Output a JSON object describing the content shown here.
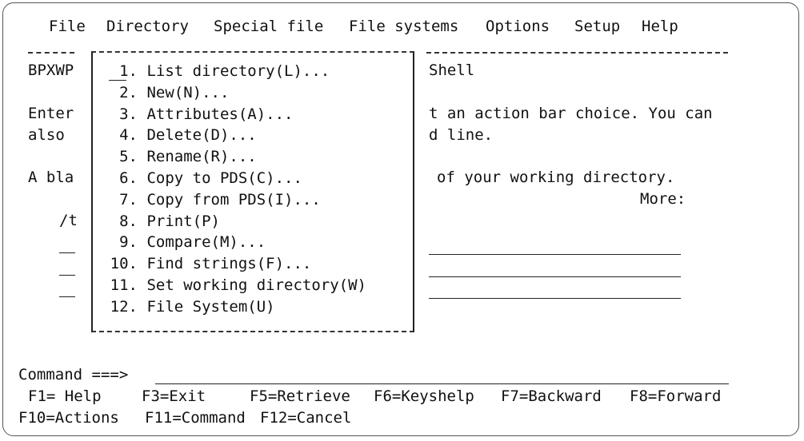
{
  "action_bar": [
    "File",
    "Directory",
    "Special file",
    "File systems",
    "Options",
    "Setup",
    "Help"
  ],
  "background": {
    "panel_id": "BPXWP",
    "panel_title": "Shell",
    "line_enter_left": "Enter",
    "line_enter_right": "t an action bar choice. You can",
    "line_also_left": "also",
    "line_also_right": "d line.",
    "line_blank_left": "A bla",
    "line_blank_right": "of your working directory.",
    "more_label": "More:",
    "path_prefix": "/t",
    "left_field_underline": "__"
  },
  "directory_menu": {
    "selection_underline": "__",
    "items": [
      {
        "num": "1.",
        "label": "List directory(L)..."
      },
      {
        "num": "2.",
        "label": "New(N)..."
      },
      {
        "num": "3.",
        "label": "Attributes(A)..."
      },
      {
        "num": "4.",
        "label": "Delete(D)..."
      },
      {
        "num": "5.",
        "label": "Rename(R)..."
      },
      {
        "num": "6.",
        "label": "Copy to PDS(C)..."
      },
      {
        "num": "7.",
        "label": "Copy from PDS(I)..."
      },
      {
        "num": "8.",
        "label": "Print(P)"
      },
      {
        "num": "9.",
        "label": "Compare(M)..."
      },
      {
        "num": "10.",
        "label": "Find strings(F)..."
      },
      {
        "num": "11.",
        "label": "Set working directory(W)"
      },
      {
        "num": "12.",
        "label": "File System(U)"
      }
    ]
  },
  "command": {
    "prompt": "Command ===>",
    "value": ""
  },
  "function_keys": {
    "row1": [
      "F1= Help",
      "F3=Exit",
      "F5=Retrieve",
      "F6=Keyshelp",
      "F7=Backward",
      "F8=Forward"
    ],
    "row2": [
      "F10=Actions",
      "F11=Command",
      "F12=Cancel"
    ]
  }
}
